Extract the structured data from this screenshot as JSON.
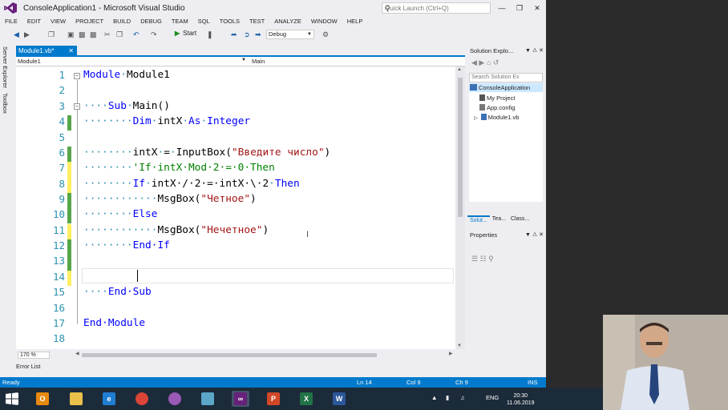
{
  "window": {
    "title": "ConsoleApplication1 - Microsoft Visual Studio",
    "quick_launch_placeholder": "Quick Launch (Ctrl+Q)",
    "controls": [
      "?",
      "—",
      "❐",
      "✕"
    ]
  },
  "menu": [
    "FILE",
    "EDIT",
    "VIEW",
    "PROJECT",
    "BUILD",
    "DEBUG",
    "TEAM",
    "SQL",
    "TOOLS",
    "TEST",
    "ANALYZE",
    "WINDOW",
    "HELP"
  ],
  "toolbar": {
    "start_label": "Start",
    "config": "Debug"
  },
  "side_tabs": [
    "Server Explorer",
    "Toolbox"
  ],
  "document": {
    "tab_label": "Module1.vb*",
    "nav_left": "Module1",
    "nav_right": "Main",
    "zoom": "170 %"
  },
  "code": {
    "line_numbers": [
      "1",
      "2",
      "3",
      "4",
      "5",
      "6",
      "7",
      "8",
      "9",
      "10",
      "11",
      "12",
      "13",
      "14",
      "15",
      "16",
      "17",
      "18"
    ],
    "lines": {
      "l1_kw": "Module",
      "l1_name": "Module1",
      "l3_kw": "Sub",
      "l3_name": "Main()",
      "l4_kw1": "Dim",
      "l4_var": "intX",
      "l4_kw2": "As",
      "l4_type": "Integer",
      "l6_a": "intX",
      "l6_b": "=",
      "l6_c": "InputBox(",
      "l6_str": "\"Введите число\"",
      "l6_d": ")",
      "l7_comment": "'If intX Mod 2 = 0 Then",
      "l8_kw1": "If",
      "l8_expr": "intX / 2 = intX \\ 2",
      "l8_kw2": "Then",
      "l9_fn": "MsgBox(",
      "l9_str": "\"Четное\"",
      "l9_end": ")",
      "l10_kw": "Else",
      "l11_fn": "MsgBox(",
      "l11_str": "\"Нечетное\"",
      "l11_end": ")",
      "l12_kw": "End If",
      "l15_kw": "End Sub",
      "l17_kw": "End Module"
    }
  },
  "panels": {
    "solution_explorer_title": "Solution Explo...",
    "search_placeholder": "Search Solution Ex",
    "tree": [
      "ConsoleApplication",
      "My Project",
      "App.config",
      "Module1.vb"
    ],
    "tabs": [
      "Solut...",
      "Tea...",
      "Class..."
    ],
    "properties_title": "Properties"
  },
  "error_list": "Error List",
  "status": {
    "state": "Ready",
    "line": "Ln 14",
    "col": "Col 9",
    "ch": "Ch 9",
    "mode": "INS"
  },
  "taskbar": {
    "lang": "ENG",
    "time": "20:30",
    "date": "11.06.2019"
  }
}
